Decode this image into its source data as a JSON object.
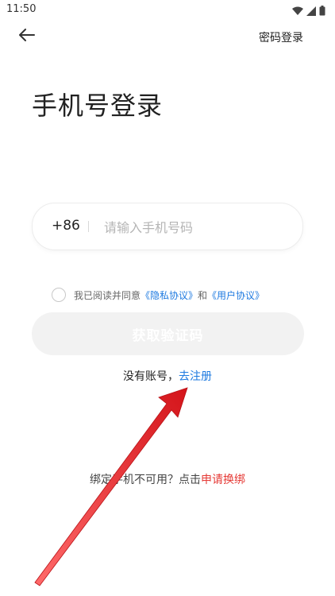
{
  "status_bar": {
    "time": "11:50",
    "icons": [
      "wifi-icon",
      "signal-icon",
      "battery-icon"
    ]
  },
  "header": {
    "back_icon": "back-arrow-icon",
    "password_login": "密码登录"
  },
  "main": {
    "title": "手机号登录",
    "country_code": "+86",
    "phone_placeholder": "请输入手机号码",
    "phone_value": "",
    "agreement": {
      "checked": false,
      "prefix": "我已阅读并同意",
      "privacy_link": "《隐私协议》",
      "and": "和",
      "user_link": "《用户协议》"
    },
    "get_code_button": "获取验证码",
    "no_account": "没有账号，",
    "register_link": "去注册",
    "rebind_prefix": "绑定手机不可用？点击",
    "rebind_link": "申请换绑"
  },
  "colors": {
    "link_blue": "#1e7ae0",
    "link_red": "#e53935",
    "button_disabled": "#f2f2f2",
    "annotation_arrow": "#e8262a"
  }
}
